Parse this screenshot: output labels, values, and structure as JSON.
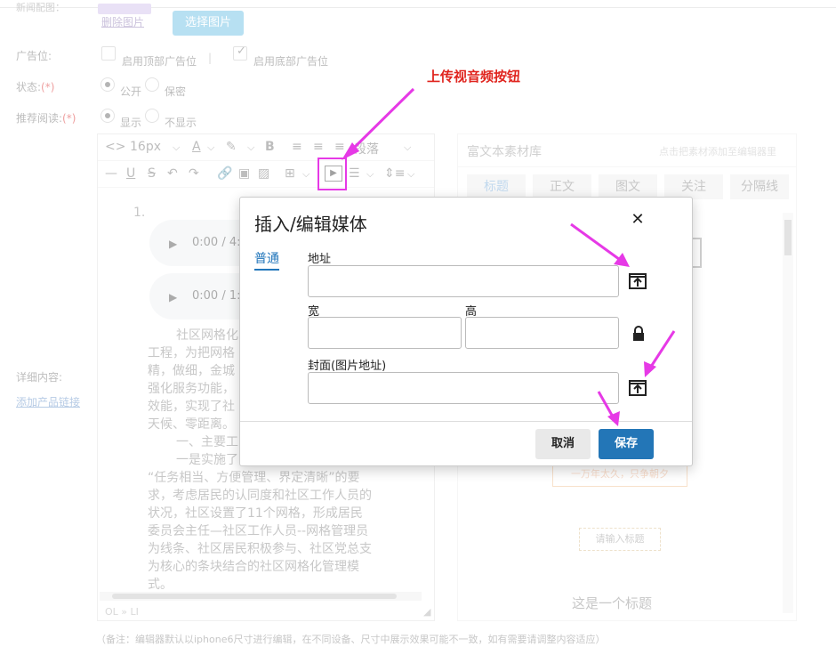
{
  "form": {
    "image_label": "新闻配图：",
    "delete_image": "删除图片",
    "pick_image": "选择图片",
    "ad_label": "广告位:",
    "ad_top": "启用顶部广告位",
    "ad_separator": "|",
    "ad_bottom": "启用底部广告位",
    "status_label": "状态:",
    "status_public": "公开",
    "status_private": "保密",
    "recommend_label": "推荐阅读:",
    "recommend_show": "显示",
    "recommend_hide": "不显示",
    "required_mark": "(*)",
    "detail_label": "详细内容:",
    "add_product_link": "添加产品链接"
  },
  "toolbar": {
    "code_icon": "<>",
    "font_size": "16px",
    "font_color": "A",
    "bold": "B",
    "paragraph": "段落"
  },
  "editor": {
    "list_number": "1.",
    "audio1_time": "0:00 / 4:",
    "audio2_time": "0:00 / 1:",
    "paragraphs": [
      "社区网格化",
      "工程，为把网格",
      "精，做细，金城",
      "强化服务功能，",
      "效能，实现了社",
      "天候、零距离。",
      "一、主要工",
      "一是实施了",
      "“任务相当、方便管理、界定清晰”的要",
      "求，考虑居民的认同度和社区工作人员的",
      "状况，社区设置了11个网格，形成居民",
      "委员会主任—社区工作人员--网格管理员",
      "为线条、社区居民积极参与、社区党总支",
      "为核心的条块结合的社区网格化管理模",
      "式。"
    ],
    "status_path": "OL » LI"
  },
  "material_panel": {
    "title": "富文本素材库",
    "hint": "点击把素材添加至编辑器里",
    "tabs": [
      "标题",
      "正文",
      "图文",
      "关注",
      "分隔线"
    ],
    "partial_text1": "明",
    "partial_text2": "题",
    "tag1": "一万年太久，只争朝夕",
    "tag2": "请输入标题",
    "sample_title": "这是一个标题"
  },
  "dialog": {
    "title": "插入/编辑媒体",
    "close": "✕",
    "tab_general": "普通",
    "address_label": "地址",
    "address_value": "",
    "width_label": "宽",
    "width_value": "",
    "height_label": "高",
    "height_value": "",
    "cover_label": "封面(图片地址)",
    "cover_value": "",
    "cancel": "取消",
    "save": "保存"
  },
  "annotation": {
    "text": "上传视音频按钮",
    "color": "#e0241e",
    "arrow_color": "#e639e6"
  },
  "footer_note": "（备注：编辑器默认以iphone6尺寸进行编辑，在不同设备、尺寸中展示效果可能不一致，如有需要请调整内容适应）"
}
